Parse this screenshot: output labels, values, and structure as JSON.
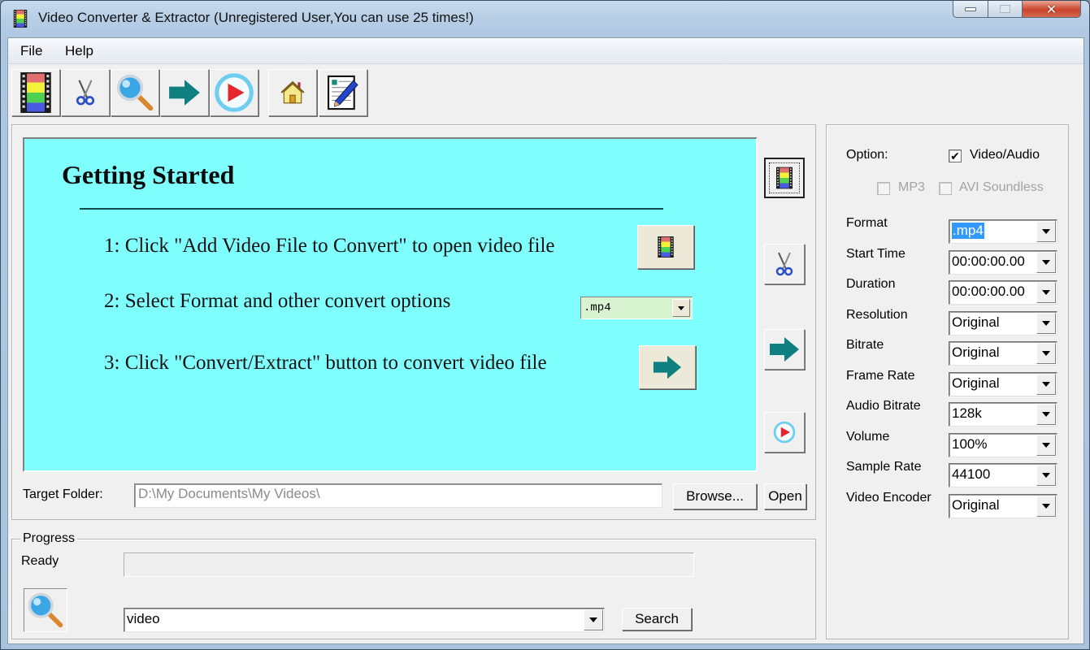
{
  "window": {
    "title": "Video Converter & Extractor (Unregistered User,You can use 25 times!)",
    "controls": {
      "minimize": "minimize",
      "maximize": "maximize",
      "close": "✕"
    }
  },
  "menu": {
    "items": [
      {
        "label": "File"
      },
      {
        "label": "Help"
      }
    ]
  },
  "toolbar": {
    "buttons": [
      {
        "name": "add-video",
        "icon": "film-strip-icon"
      },
      {
        "name": "cut",
        "icon": "scissors-icon"
      },
      {
        "name": "search",
        "icon": "magnifier-icon"
      },
      {
        "name": "convert",
        "icon": "arrow-right-icon"
      },
      {
        "name": "play",
        "icon": "play-circle-icon"
      },
      {
        "name": "home",
        "icon": "house-icon"
      },
      {
        "name": "edit",
        "icon": "pencil-document-icon"
      }
    ]
  },
  "getting_started": {
    "title": "Getting Started",
    "steps": [
      {
        "text": "1: Click \"Add Video File to Convert\" to open video file"
      },
      {
        "text": "2: Select Format and other convert options"
      },
      {
        "text": "3: Click \"Convert/Extract\" button to convert video file"
      }
    ],
    "format_combo_value": ".mp4"
  },
  "side_buttons": [
    {
      "name": "add-video",
      "icon": "film-strip-icon"
    },
    {
      "name": "cut",
      "icon": "scissors-icon"
    },
    {
      "name": "convert",
      "icon": "arrow-right-icon"
    },
    {
      "name": "play",
      "icon": "play-circle-icon"
    }
  ],
  "target_folder": {
    "label": "Target Folder:",
    "value": "D:\\My Documents\\My Videos\\",
    "browse_label": "Browse...",
    "open_label": "Open"
  },
  "progress": {
    "legend": "Progress",
    "status": "Ready",
    "percent": 0,
    "search_value": "video",
    "search_button": "Search"
  },
  "options": {
    "option_label": "Option:",
    "checkboxes": [
      {
        "label": "Video/Audio",
        "checked": true,
        "enabled": true
      },
      {
        "label": "MP3",
        "checked": false,
        "enabled": false
      },
      {
        "label": "AVI Soundless",
        "checked": false,
        "enabled": false
      }
    ],
    "fields": [
      {
        "label": "Format",
        "value": ".mp4",
        "selected": true
      },
      {
        "label": "Start Time",
        "value": "00:00:00.00"
      },
      {
        "label": "Duration",
        "value": "00:00:00.00"
      },
      {
        "label": "Resolution",
        "value": "Original"
      },
      {
        "label": "Bitrate",
        "value": "Original"
      },
      {
        "label": "Frame Rate",
        "value": "Original"
      },
      {
        "label": "Audio Bitrate",
        "value": "128k"
      },
      {
        "label": "Volume",
        "value": "100%"
      },
      {
        "label": "Sample Rate",
        "value": "44100"
      },
      {
        "label": "Video Encoder",
        "value": "Original"
      }
    ]
  },
  "colors": {
    "getting_started_bg": "#80ffff",
    "arrow_teal": "#0f7f7f",
    "selection_blue": "#3399ff"
  }
}
